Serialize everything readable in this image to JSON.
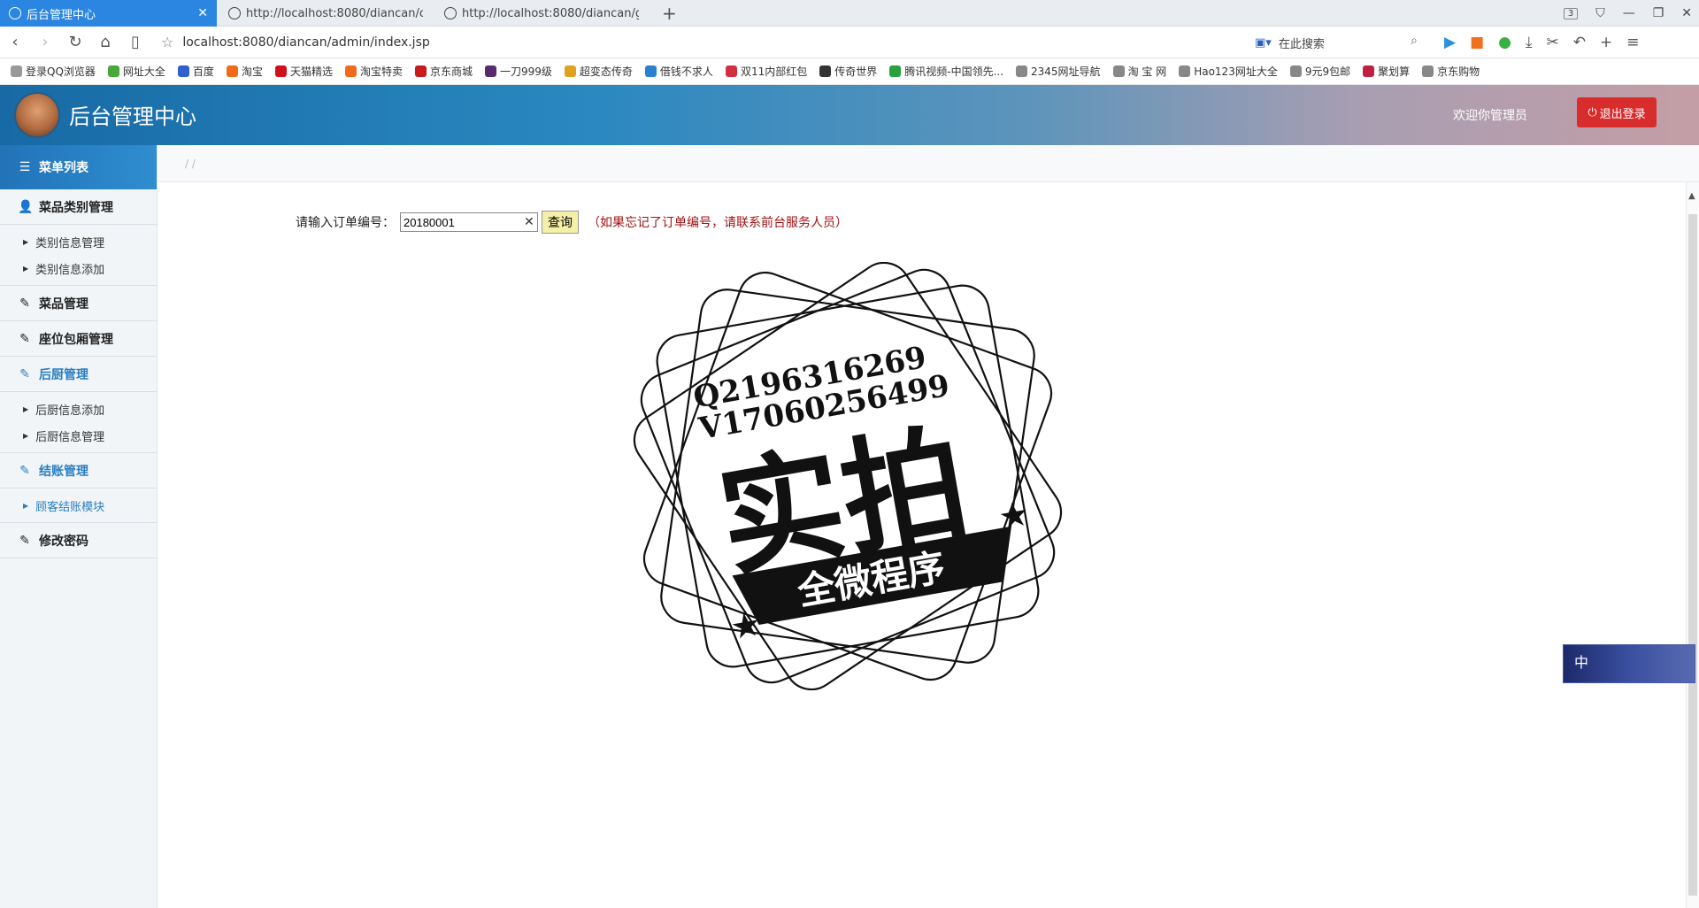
{
  "browser": {
    "tabs": [
      {
        "title": "后台管理中心",
        "active": true
      },
      {
        "title": "http://localhost:8080/diancan/orde",
        "active": false
      },
      {
        "title": "http://localhost:8080/diancan/goo",
        "active": false
      }
    ],
    "tab_count": "3",
    "address": "localhost:8080/diancan/admin/index.jsp",
    "search_placeholder": "在此搜索",
    "bookmarks": [
      {
        "label": "登录QQ浏览器",
        "color": "#999999"
      },
      {
        "label": "网址大全",
        "color": "#4aa83a"
      },
      {
        "label": "百度",
        "color": "#3060d0"
      },
      {
        "label": "淘宝",
        "color": "#f06a1a"
      },
      {
        "label": "天猫精选",
        "color": "#d0101a"
      },
      {
        "label": "淘宝特卖",
        "color": "#f06a1a"
      },
      {
        "label": "京东商城",
        "color": "#c81a1a"
      },
      {
        "label": "一刀999级",
        "color": "#5a2a70"
      },
      {
        "label": "超变态传奇",
        "color": "#e0a020"
      },
      {
        "label": "借钱不求人",
        "color": "#2a80d0"
      },
      {
        "label": "双11内部红包",
        "color": "#d03040"
      },
      {
        "label": "传奇世界",
        "color": "#333333"
      },
      {
        "label": "腾讯视频-中国领先...",
        "color": "#2aa040"
      },
      {
        "label": "2345网址导航",
        "color": "#888888"
      },
      {
        "label": "淘 宝 网",
        "color": "#888888"
      },
      {
        "label": "Hao123网址大全",
        "color": "#888888"
      },
      {
        "label": "9元9包邮",
        "color": "#888888"
      },
      {
        "label": "聚划算",
        "color": "#c02040"
      },
      {
        "label": "京东购物",
        "color": "#888888"
      }
    ]
  },
  "header": {
    "title": "后台管理中心",
    "welcome": "欢迎你管理员",
    "logout": "退出登录",
    "logout_color": "#d92c2c"
  },
  "sidebar": {
    "head": "菜单列表",
    "groups": [
      {
        "label": "菜品类别管理",
        "icon": "user-icon",
        "subs": [
          "类别信息管理",
          "类别信息添加"
        ]
      },
      {
        "label": "菜品管理",
        "icon": "edit-icon",
        "subs": []
      },
      {
        "label": "座位包厢管理",
        "icon": "edit-icon",
        "subs": []
      },
      {
        "label": "后厨管理",
        "icon": "edit-icon",
        "subs": [
          "后厨信息添加",
          "后厨信息管理"
        ]
      },
      {
        "label": "结账管理",
        "icon": "edit-icon",
        "subs": [
          "顾客结账模块"
        ]
      },
      {
        "label": "修改密码",
        "icon": "edit-icon",
        "subs": []
      }
    ]
  },
  "breadcrumb": "/ /",
  "query": {
    "label": "请输入订单编号：",
    "value": "20180001",
    "button": "查询",
    "hint": "（如果忘记了订单编号，请联系前台服务人员）"
  },
  "stamp": {
    "line1": "Q2196316269",
    "line2": "V17060256499",
    "main": "实拍",
    "banner": "全微程序"
  },
  "ime": {
    "label": "中"
  }
}
